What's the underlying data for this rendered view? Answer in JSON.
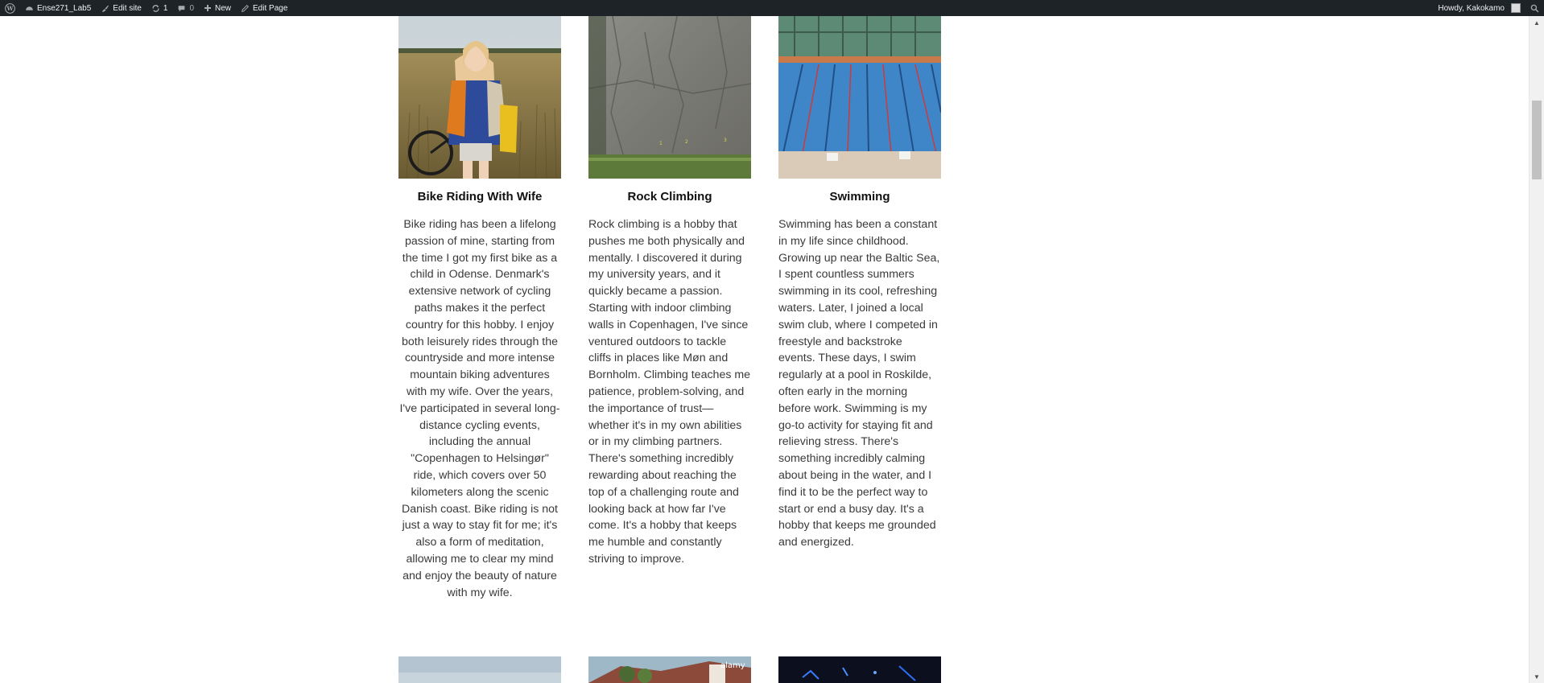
{
  "adminbar": {
    "site_name": "Ense271_Lab5",
    "edit_site": "Edit site",
    "updates_count": "1",
    "comments_count": "0",
    "new_label": "New",
    "edit_page": "Edit Page",
    "greeting": "Howdy, Kakokamo"
  },
  "hobbies": [
    {
      "title": "Bike Riding With Wife",
      "text": "Bike riding has been a lifelong passion of mine, starting from the time I got my first bike as a child in Odense. Denmark's extensive network of cycling paths makes it the perfect country for this hobby. I enjoy both leisurely rides through the countryside and more intense mountain biking adventures with my wife. Over the years, I've participated in several long-distance cycling events, including the annual \"Copenhagen to Helsingør\" ride, which covers over 50 kilometers along the scenic Danish coast. Bike riding is not just a way to stay fit for me; it's also a form of meditation, allowing me to clear my mind and enjoy the beauty of nature with my wife."
    },
    {
      "title": "Rock Climbing",
      "text": "Rock climbing is a hobby that pushes me both physically and mentally. I discovered it during my university years, and it quickly became a passion. Starting with indoor climbing walls in Copenhagen, I've since ventured outdoors to tackle cliffs in places like Møn and Bornholm. Climbing teaches me patience, problem-solving, and the importance of trust—whether it's in my own abilities or in my climbing partners. There's something incredibly rewarding about reaching the top of a challenging route and looking back at how far I've come. It's a hobby that keeps me humble and constantly striving to improve."
    },
    {
      "title": "Swimming",
      "text": "Swimming has been a constant in my life since childhood. Growing up near the Baltic Sea, I spent countless summers swimming in its cool, refreshing waters. Later, I joined a local swim club, where I competed in freestyle and backstroke events. These days, I swim regularly at a pool in Roskilde, often early in the morning before work. Swimming is my go-to activity for staying fit and relieving stress. There's something incredibly calming about being in the water, and I find it to be the perfect way to start or end a busy day. It's a hobby that keeps me grounded and energized."
    }
  ],
  "bottom_images": [
    {
      "name": "sky-photo"
    },
    {
      "name": "house-photo",
      "watermark": "alamy"
    },
    {
      "name": "night-photo"
    }
  ]
}
